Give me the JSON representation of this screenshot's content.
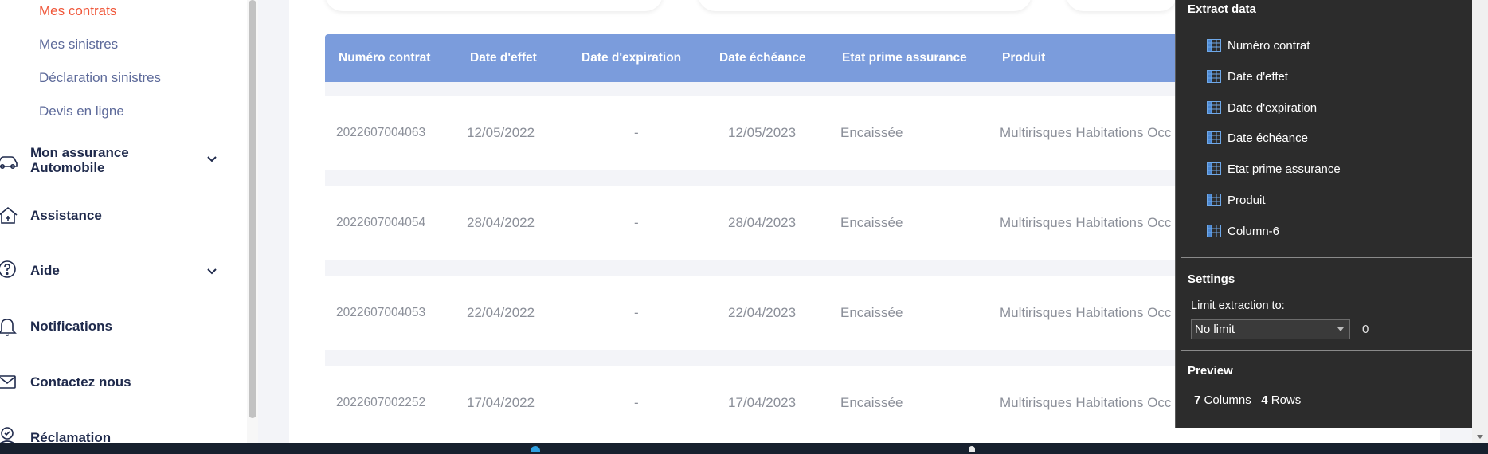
{
  "sidebar": {
    "sub_items": [
      {
        "label": "Mes contrats",
        "active": true
      },
      {
        "label": "Mes sinistres",
        "active": false
      },
      {
        "label": "Déclaration sinistres",
        "active": false
      },
      {
        "label": "Devis en ligne",
        "active": false
      }
    ],
    "nav_items": [
      {
        "label_line1": "Mon assurance",
        "label_line2": "Automobile",
        "icon": "car-icon",
        "has_chevron": true
      },
      {
        "label": "Assistance",
        "icon": "assistance-icon",
        "has_chevron": false
      },
      {
        "label": "Aide",
        "icon": "help-icon",
        "has_chevron": true
      },
      {
        "label": "Notifications",
        "icon": "bell-icon",
        "has_chevron": false
      },
      {
        "label": "Contactez nous",
        "icon": "mail-icon",
        "has_chevron": false
      },
      {
        "label": "Réclamation",
        "icon": "reclamation-icon",
        "has_chevron": false
      }
    ]
  },
  "table": {
    "headers": [
      "Numéro contrat",
      "Date d'effet",
      "Date d'expiration",
      "Date échéance",
      "Etat prime assurance",
      "Produit"
    ],
    "rows": [
      [
        "2022607004063",
        "12/05/2022",
        "-",
        "12/05/2023",
        "Encaissée",
        "Multirisques Habitations Occ"
      ],
      [
        "2022607004054",
        "28/04/2022",
        "-",
        "28/04/2023",
        "Encaissée",
        "Multirisques Habitations Occ"
      ],
      [
        "2022607004053",
        "22/04/2022",
        "-",
        "22/04/2023",
        "Encaissée",
        "Multirisques Habitations Occ"
      ],
      [
        "2022607002252",
        "17/04/2022",
        "-",
        "17/04/2023",
        "Encaissée",
        "Multirisques Habitations Occ"
      ]
    ]
  },
  "extract_panel": {
    "title": "Extract data",
    "columns": [
      "Numéro contrat",
      "Date d'effet",
      "Date d'expiration",
      "Date échéance",
      "Etat prime assurance",
      "Produit",
      "Column-6"
    ],
    "settings_title": "Settings",
    "limit_label": "Limit extraction to:",
    "limit_select": "No limit",
    "limit_value": "0",
    "preview_title": "Preview",
    "preview_columns_count": "7",
    "preview_columns_label": "Columns",
    "preview_rows_count": "4",
    "preview_rows_label": "Rows"
  },
  "colors": {
    "active": "#f0573a",
    "header_bg": "#7b9cdc",
    "panel_bg": "#2c2c2c"
  }
}
